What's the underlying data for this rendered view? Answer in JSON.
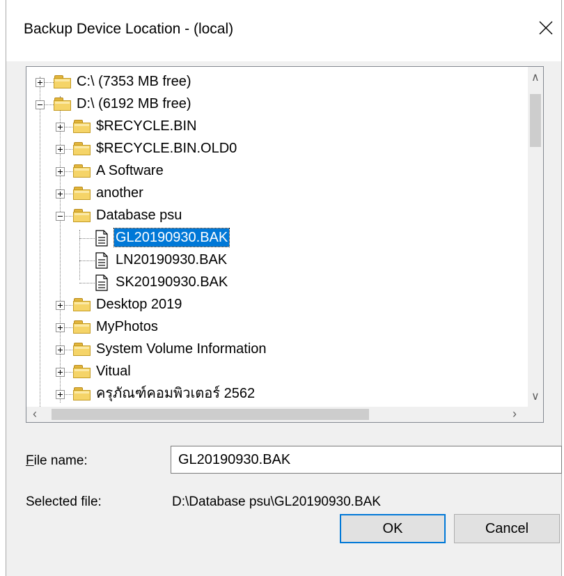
{
  "window": {
    "title": "Backup Device Location - (local)",
    "close_glyph": "close-icon"
  },
  "tree": {
    "drives": [
      {
        "label": "C:\\ (7353 MB free)",
        "expanded": false
      },
      {
        "label": "D:\\ (6192 MB free)",
        "expanded": true
      }
    ],
    "folders": [
      "$RECYCLE.BIN",
      "$RECYCLE.BIN.OLD0",
      "A Software",
      "another",
      "Database psu",
      "Desktop 2019",
      "MyPhotos",
      "System Volume Information",
      "Vitual",
      "ครุภัณฑ์คอมพิวเตอร์ 2562"
    ],
    "files": [
      "GL20190930.BAK",
      "LN20190930.BAK",
      "SK20190930.BAK"
    ],
    "selected_file": "GL20190930.BAK"
  },
  "form": {
    "file_name_label_first": "F",
    "file_name_label_rest": "ile name:",
    "file_name_value": "GL20190930.BAK",
    "selected_file_label": "Selected file:",
    "selected_file_value": "D:\\Database psu\\GL20190930.BAK"
  },
  "buttons": {
    "ok": "OK",
    "cancel": "Cancel"
  },
  "colors": {
    "selection": "#0078d7",
    "dialog_bg": "#f0f0f0",
    "folder": "#f5d468"
  }
}
